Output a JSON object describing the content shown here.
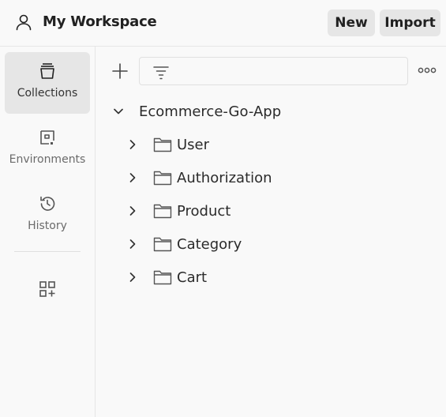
{
  "header": {
    "workspace_title": "My Workspace",
    "new_label": "New",
    "import_label": "Import",
    "workspace_icon": "user-icon"
  },
  "sidebar": {
    "items": [
      {
        "label": "Collections",
        "icon": "collections-icon",
        "active": true
      },
      {
        "label": "Environments",
        "icon": "environments-icon",
        "active": false
      },
      {
        "label": "History",
        "icon": "history-icon",
        "active": false
      }
    ],
    "extra_icon": "add-widgets-icon"
  },
  "toolbar": {
    "add_icon": "plus-icon",
    "filter_icon": "filter-icon",
    "more_icon": "more-options-icon"
  },
  "tree": {
    "root": {
      "label": "Ecommerce-Go-App",
      "expanded": true
    },
    "folders": [
      {
        "label": "User"
      },
      {
        "label": "Authorization"
      },
      {
        "label": "Product"
      },
      {
        "label": "Category"
      },
      {
        "label": "Cart"
      }
    ]
  },
  "colors": {
    "background": "#f9f9f9",
    "active_bg": "#e6e6e6",
    "text": "#212121",
    "border": "#e6e6e6"
  }
}
